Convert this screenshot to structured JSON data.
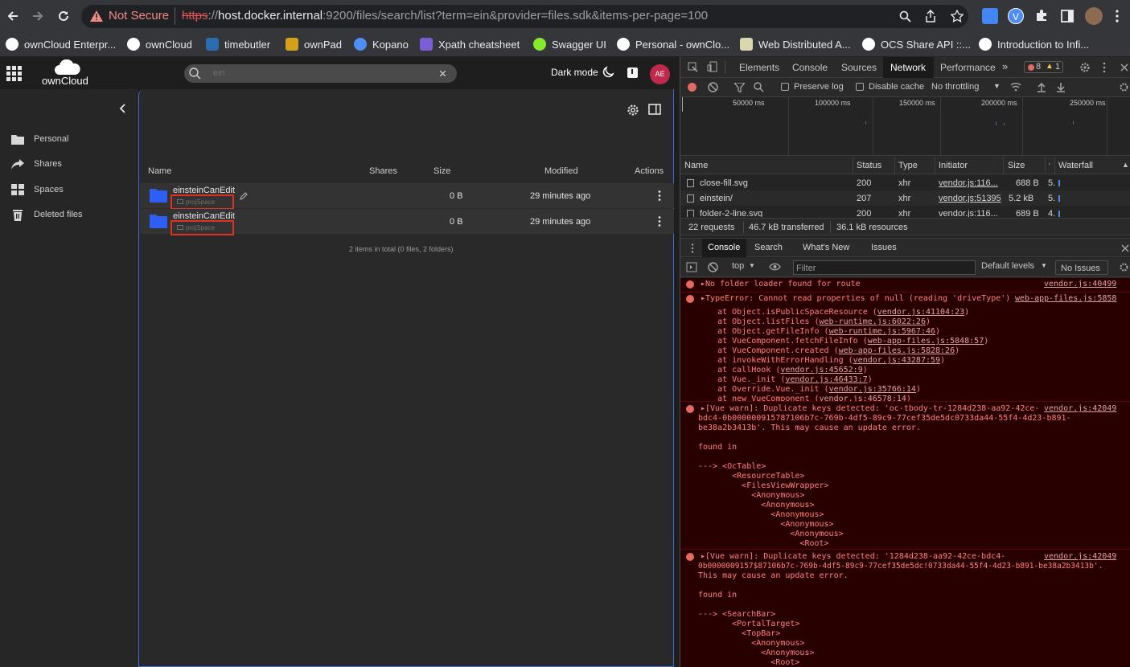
{
  "browser": {
    "security_label": "Not Secure",
    "url_scheme": "https",
    "url_sep": "://",
    "url_host": "host.docker.internal",
    "url_rest": ":9200/files/search/list?term=ein&provider=files.sdk&items-per-page=100",
    "profile_letter": "V"
  },
  "bookmarks": [
    {
      "label": "ownCloud Enterpr...",
      "color": "#ffffff"
    },
    {
      "label": "ownCloud",
      "color": "#ffffff"
    },
    {
      "label": "timebutler",
      "color": "#2b6cb0"
    },
    {
      "label": "ownPad",
      "color": "#d4a017"
    },
    {
      "label": "Kopano",
      "color": "#4f8ef7"
    },
    {
      "label": "Xpath cheatsheet",
      "color": "#7b5ed6"
    },
    {
      "label": "Swagger UI",
      "color": "#85ea2d"
    },
    {
      "label": "Personal - ownClo...",
      "color": "#ffffff"
    },
    {
      "label": "Web Distributed A...",
      "color": "#ffffff"
    },
    {
      "label": "OCS Share API ::...",
      "color": "#ffffff"
    },
    {
      "label": "Introduction to Infi...",
      "color": "#ffffff"
    }
  ],
  "app": {
    "logo_text": "ownCloud",
    "search_placeholder": "ein",
    "dark_mode_label": "Dark mode",
    "avatar_initials": "AE",
    "avatar_color": "#c0294b",
    "sidebar": [
      {
        "label": "Personal"
      },
      {
        "label": "Shares"
      },
      {
        "label": "Spaces"
      },
      {
        "label": "Deleted files"
      }
    ],
    "columns": {
      "name": "Name",
      "shares": "Shares",
      "size": "Size",
      "modified": "Modified",
      "actions": "Actions"
    },
    "rows": [
      {
        "name": "einsteinCanEdit",
        "space": "projSpace",
        "size": "0 B",
        "modified": "29 minutes ago"
      },
      {
        "name": "einsteinCanEdit",
        "space": "projSpace",
        "size": "0 B",
        "modified": "29 minutes ago"
      }
    ],
    "footer": "2 items in total (0 files, 2 folders)"
  },
  "devtools": {
    "tabs": [
      "Elements",
      "Console",
      "Sources",
      "Network",
      "Performance"
    ],
    "active_tab": "Network",
    "error_count": "8",
    "warn_count": "1",
    "preserve_log": "Preserve log",
    "disable_cache": "Disable cache",
    "throttling": "No throttling",
    "timeline_ticks": [
      "50000 ms",
      "100000 ms",
      "150000 ms",
      "200000 ms",
      "250000 ms"
    ],
    "net_columns": {
      "name": "Name",
      "status": "Status",
      "type": "Type",
      "initiator": "Initiator",
      "size": "Size",
      "dot": "·",
      "waterfall": "Waterfall"
    },
    "net_rows": [
      {
        "name": "close-fill.svg",
        "status": "200",
        "type": "xhr",
        "initiator": "vendor.js:116...",
        "size": "688 B",
        "time": "5."
      },
      {
        "name": "einstein/",
        "status": "207",
        "type": "xhr",
        "initiator": "vendor.js:51395",
        "size": "5.2 kB",
        "time": "5."
      },
      {
        "name": "folder-2-line.svg",
        "status": "200",
        "type": "xhr",
        "initiator": "vendor.js:116...",
        "size": "689 B",
        "time": "4."
      }
    ],
    "summary": {
      "requests": "22 requests",
      "transferred": "46.7 kB transferred",
      "resources": "36.1 kB resources"
    },
    "drawer_tabs": [
      "Console",
      "Search",
      "What's New",
      "Issues"
    ],
    "console_context": "top",
    "filter_placeholder": "Filter",
    "levels": "Default levels",
    "no_issues": "No Issues",
    "msg1": {
      "text": "No folder loader found for route",
      "source": "vendor.js:40499"
    },
    "msg2": {
      "text": "TypeError: Cannot read properties of null (reading 'driveType')",
      "source": "web-app-files.js:5858",
      "stack": [
        {
          "pre": "    at Object.isPublicSpaceResource (",
          "link": "vendor.js:41104:23",
          "post": ")"
        },
        {
          "pre": "    at Object.listFiles (",
          "link": "web-runtime.js:6022:26",
          "post": ")"
        },
        {
          "pre": "    at Object.getFileInfo (",
          "link": "web-runtime.js:5967:46",
          "post": ")"
        },
        {
          "pre": "    at VueComponent.fetchFileInfo (",
          "link": "web-app-files.js:5848:57",
          "post": ")"
        },
        {
          "pre": "    at VueComponent.created (",
          "link": "web-app-files.js:5828:26",
          "post": ")"
        },
        {
          "pre": "    at invokeWithErrorHandling (",
          "link": "vendor.js:43287:59",
          "post": ")"
        },
        {
          "pre": "    at callHook (",
          "link": "vendor.js:45652:9",
          "post": ")"
        },
        {
          "pre": "    at Vue._init (",
          "link": "vendor.js:46433:7",
          "post": ")"
        },
        {
          "pre": "    at Override.Vue._init (",
          "link": "vendor.js:35766:14",
          "post": ")"
        },
        {
          "pre": "    at new VueComponent (",
          "link": "vendor.js:46578:14",
          "post": ")"
        }
      ]
    },
    "msg3": {
      "lines": [
        "[Vue warn]: Duplicate keys detected: 'oc-tbody-tr-1284d238-aa92-42ce-",
        "bdc4-0b000000915787106b7c-769b-4df5-89c9-77cef35de5dc0733da44-55f4-4d23-b891-",
        "be38a2b3413b'. This may cause an update error.",
        "",
        "found in",
        "",
        "---> <OcTable>",
        "       <ResourceTable>",
        "         <FilesViewWrapper>",
        "           <Anonymous>",
        "             <Anonymous>",
        "               <Anonymous>",
        "                 <Anonymous>",
        "                   <Anonymous>",
        "                     <Root>"
      ],
      "source": "vendor.js:42049"
    },
    "msg4": {
      "lines": [
        "[Vue warn]: Duplicate keys detected: '1284d238-aa92-42ce-bdc4-",
        "0b0000009157$87106b7c-769b-4df5-89c9-77cef35de5dc!0733da44-55f4-4d23-b891-be38a2b3413b'.",
        "This may cause an update error.",
        "",
        "found in",
        "",
        "---> <SearchBar>",
        "       <PortalTarget>",
        "         <TopBar>",
        "           <Anonymous>",
        "             <Anonymous>",
        "               <Root>"
      ],
      "source": "vendor.js:42049"
    }
  }
}
